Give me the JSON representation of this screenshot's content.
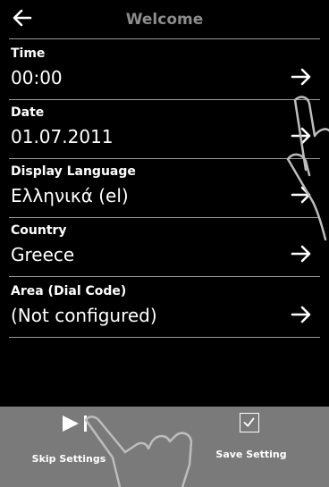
{
  "header": {
    "title": "Welcome",
    "back_icon": "arrow-left-icon"
  },
  "rows": [
    {
      "label": "Time",
      "value": "00:00"
    },
    {
      "label": "Date",
      "value": "01.07.2011"
    },
    {
      "label": "Display Language",
      "value": "Ελληνικά (el)"
    },
    {
      "label": "Country",
      "value": "Greece"
    },
    {
      "label": "Area (Dial Code)",
      "value": "(Not configured)"
    }
  ],
  "footer": {
    "skip_label": "Skip Settings",
    "save_label": "Save Setting",
    "skip_icon": "play-skip-icon",
    "save_icon": "checkbox-check-icon"
  },
  "colors": {
    "background": "#000000",
    "footer": "#7a7a7a",
    "title_text": "#8c8c8c"
  }
}
